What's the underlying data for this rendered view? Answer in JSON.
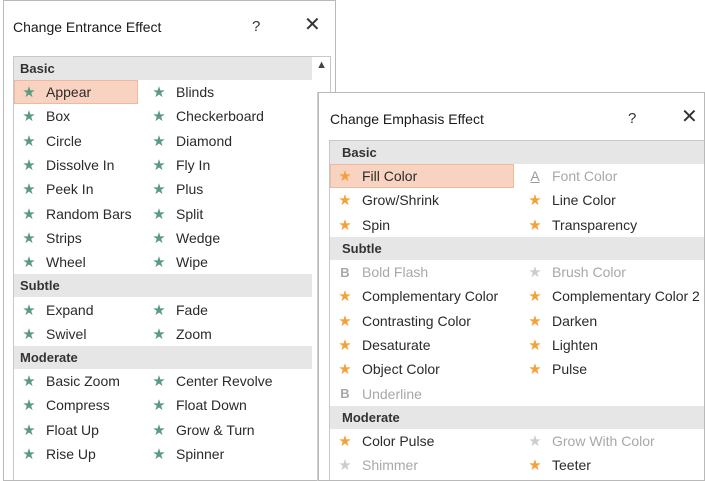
{
  "entrance": {
    "title": "Change Entrance Effect",
    "help": "?",
    "close": "✕",
    "sections": [
      {
        "header": "Basic",
        "items": [
          {
            "label": "Appear",
            "icon": "star-green-icon",
            "selected": true
          },
          {
            "label": "Blinds",
            "icon": "star-green-icon"
          },
          {
            "label": "Box",
            "icon": "star-green-icon"
          },
          {
            "label": "Checkerboard",
            "icon": "star-green-icon"
          },
          {
            "label": "Circle",
            "icon": "star-green-icon"
          },
          {
            "label": "Diamond",
            "icon": "star-green-icon"
          },
          {
            "label": "Dissolve In",
            "icon": "star-green-icon"
          },
          {
            "label": "Fly In",
            "icon": "star-green-icon"
          },
          {
            "label": "Peek In",
            "icon": "star-green-icon"
          },
          {
            "label": "Plus",
            "icon": "star-green-icon"
          },
          {
            "label": "Random Bars",
            "icon": "star-green-icon"
          },
          {
            "label": "Split",
            "icon": "star-green-icon"
          },
          {
            "label": "Strips",
            "icon": "star-green-icon"
          },
          {
            "label": "Wedge",
            "icon": "star-green-icon"
          },
          {
            "label": "Wheel",
            "icon": "star-green-icon"
          },
          {
            "label": "Wipe",
            "icon": "star-green-icon"
          }
        ]
      },
      {
        "header": "Subtle",
        "items": [
          {
            "label": "Expand",
            "icon": "star-green-icon"
          },
          {
            "label": "Fade",
            "icon": "star-green-icon"
          },
          {
            "label": "Swivel",
            "icon": "star-green-icon"
          },
          {
            "label": "Zoom",
            "icon": "star-green-icon"
          }
        ]
      },
      {
        "header": "Moderate",
        "items": [
          {
            "label": "Basic Zoom",
            "icon": "star-green-icon"
          },
          {
            "label": "Center Revolve",
            "icon": "star-green-icon"
          },
          {
            "label": "Compress",
            "icon": "star-green-icon"
          },
          {
            "label": "Float Down",
            "icon": "star-green-icon"
          },
          {
            "label": "Float Up",
            "icon": "star-green-icon"
          },
          {
            "label": "Grow & Turn",
            "icon": "star-green-icon"
          },
          {
            "label": "Rise Up",
            "icon": "star-green-icon"
          },
          {
            "label": "Spinner",
            "icon": "star-green-icon"
          }
        ]
      }
    ]
  },
  "emphasis": {
    "title": "Change Emphasis Effect",
    "help": "?",
    "close": "✕",
    "sections": [
      {
        "header": "Basic",
        "items": [
          {
            "label": "Fill Color",
            "icon": "star-gold-icon",
            "selected": true
          },
          {
            "label": "Font Color",
            "icon": "font-color-icon",
            "disabled": true
          },
          {
            "label": "Grow/Shrink",
            "icon": "star-gold-icon"
          },
          {
            "label": "Line Color",
            "icon": "star-gold-icon"
          },
          {
            "label": "Spin",
            "icon": "star-gold-icon"
          },
          {
            "label": "Transparency",
            "icon": "star-gold-icon"
          }
        ]
      },
      {
        "header": "Subtle",
        "items": [
          {
            "label": "Bold Flash",
            "icon": "bold-icon",
            "disabled": true
          },
          {
            "label": "Brush Color",
            "icon": "star-gray-icon",
            "disabled": true
          },
          {
            "label": "Complementary Color",
            "icon": "star-gold-icon"
          },
          {
            "label": "Complementary Color 2",
            "icon": "star-gold-icon"
          },
          {
            "label": "Contrasting Color",
            "icon": "star-gold-icon"
          },
          {
            "label": "Darken",
            "icon": "star-gold-icon"
          },
          {
            "label": "Desaturate",
            "icon": "star-gold-icon"
          },
          {
            "label": "Lighten",
            "icon": "star-gold-icon"
          },
          {
            "label": "Object Color",
            "icon": "star-gold-icon"
          },
          {
            "label": "Pulse",
            "icon": "star-gold-icon"
          },
          {
            "label": "Underline",
            "icon": "bold-icon",
            "disabled": true
          }
        ]
      },
      {
        "header": "Moderate",
        "items": [
          {
            "label": "Color Pulse",
            "icon": "star-gold-icon"
          },
          {
            "label": "Grow With Color",
            "icon": "star-gray-icon",
            "disabled": true
          },
          {
            "label": "Shimmer",
            "icon": "star-gray-icon",
            "disabled": true
          },
          {
            "label": "Teeter",
            "icon": "star-gold-icon"
          }
        ]
      }
    ]
  },
  "colors": {
    "selected_bg": "#f9d3c2",
    "entrance_star": "#5b9a80",
    "emphasis_star": "#f1a23a"
  }
}
